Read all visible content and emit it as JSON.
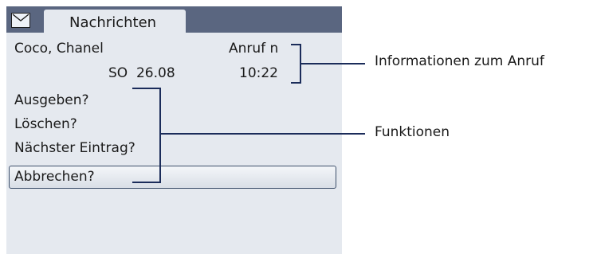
{
  "header": {
    "icon": "mail-icon",
    "tab_label": "Nachrichten"
  },
  "entry": {
    "caller_name": "Coco, Chanel",
    "call_type": "Anruf n",
    "date": "SO  26.08",
    "time": "10:22"
  },
  "menu": {
    "items": [
      {
        "label": "Ausgeben?"
      },
      {
        "label": "Löschen?"
      },
      {
        "label": "Nächster Eintrag?"
      },
      {
        "label": "Abbrechen?"
      }
    ],
    "selected_index": 3
  },
  "annotations": {
    "call_info": "Informationen zum Anruf",
    "functions": "Funktionen"
  },
  "colors": {
    "header_bar": "#5a6680",
    "screen_bg": "#e5e9ef",
    "bracket": "#1b2c5a"
  }
}
